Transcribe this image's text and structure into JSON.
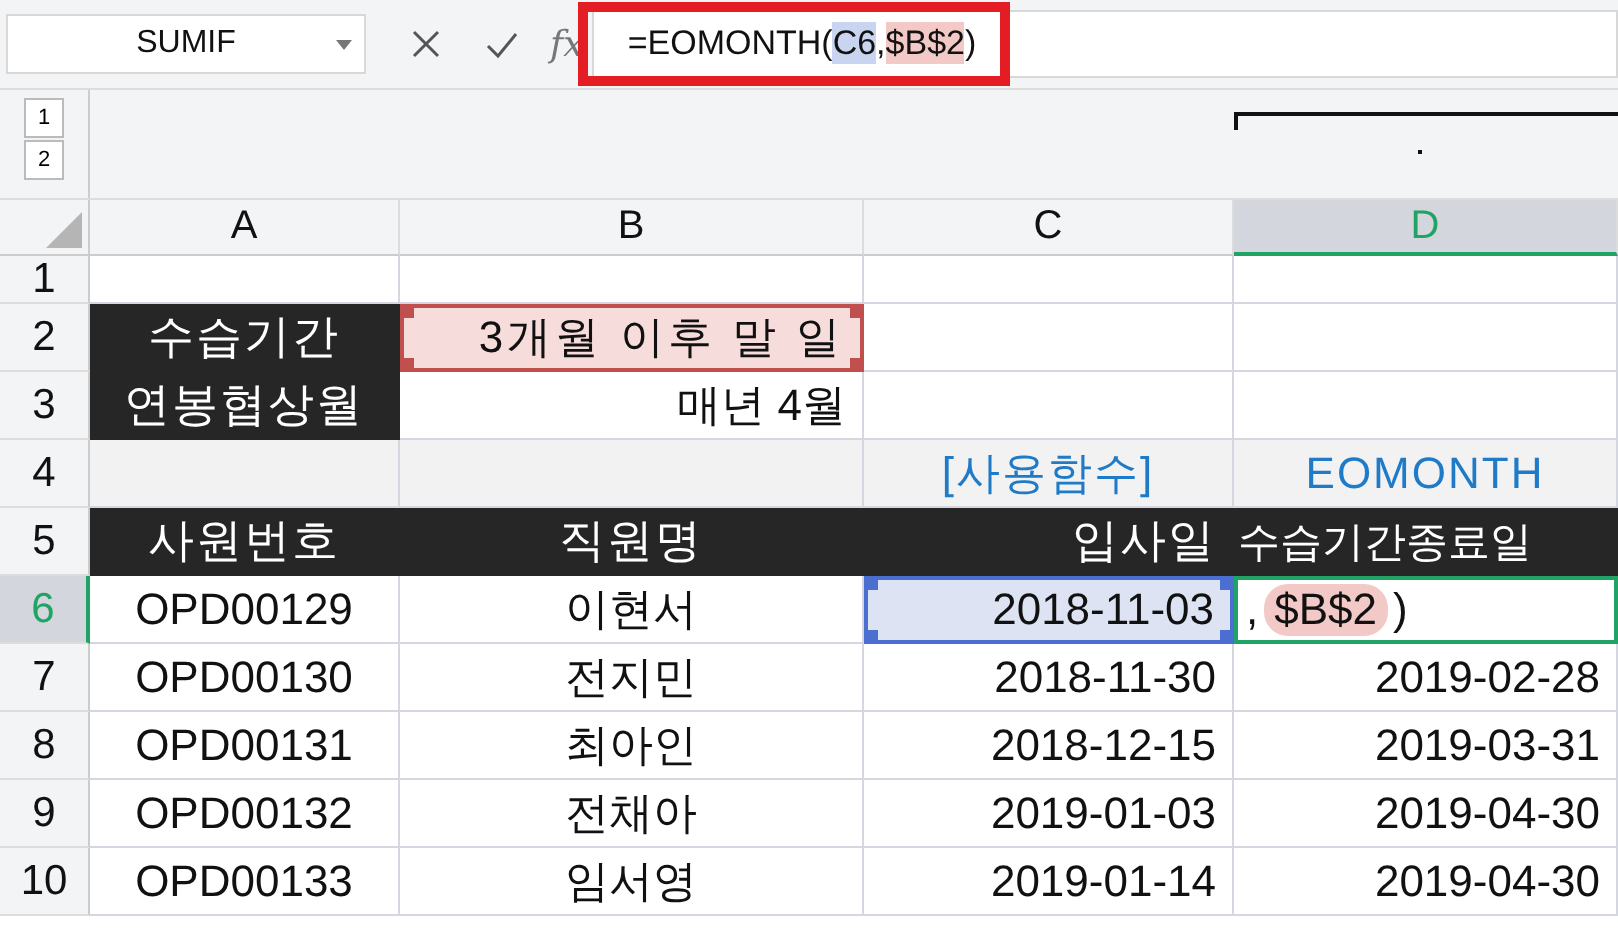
{
  "formula_bar": {
    "name_box": "SUMIF",
    "fx": "fx",
    "highlighted": true,
    "formula": [
      {
        "text": "=EOMONTH("
      },
      {
        "text": "C6",
        "color": "#c9d5f0"
      },
      {
        "text": ","
      },
      {
        "text": "$B$2",
        "color": "#f2c9c6"
      },
      {
        "text": ")"
      }
    ]
  },
  "outline_levels": [
    "1",
    "2"
  ],
  "columns": [
    {
      "label": "A",
      "selected": false
    },
    {
      "label": "B",
      "selected": false
    },
    {
      "label": "C",
      "selected": false
    },
    {
      "label": "D",
      "selected": true
    }
  ],
  "rows": [
    {
      "header": "1",
      "selected": false,
      "cells": [
        {
          "kind": "text"
        },
        {
          "kind": "text"
        },
        {
          "kind": "text"
        },
        {
          "kind": "text"
        }
      ]
    },
    {
      "header": "2",
      "selected": false,
      "cells": [
        {
          "kind": "dark",
          "text": "수습기간"
        },
        {
          "kind": "ref-pink",
          "text": "3개월 이후 말 일"
        },
        {
          "kind": "text"
        },
        {
          "kind": "text"
        }
      ]
    },
    {
      "header": "3",
      "selected": false,
      "cells": [
        {
          "kind": "dark",
          "text": "연봉협상월"
        },
        {
          "kind": "value",
          "text": "매년 4월"
        },
        {
          "kind": "text"
        },
        {
          "kind": "text"
        }
      ]
    },
    {
      "header": "4",
      "selected": false,
      "cells": [
        {
          "kind": "band"
        },
        {
          "kind": "band"
        },
        {
          "kind": "note",
          "text": "[사용함수]"
        },
        {
          "kind": "note",
          "text": "EOMONTH"
        }
      ]
    },
    {
      "header": "5",
      "selected": false,
      "cells": [
        {
          "kind": "dark",
          "text": "사원번호"
        },
        {
          "kind": "dark",
          "text": "직원명"
        },
        {
          "kind": "dark-value",
          "text": "입사일"
        },
        {
          "kind": "dark-overflow",
          "text": "수습기간종료일"
        }
      ]
    },
    {
      "header": "6",
      "selected": true,
      "cells": [
        {
          "kind": "text",
          "text": "OPD00129"
        },
        {
          "kind": "text",
          "text": "이현서"
        },
        {
          "kind": "ref-blue",
          "text": "2018-11-03"
        },
        {
          "kind": "editing",
          "parts": [
            {
              "text": ","
            },
            {
              "text": "$B$2",
              "color": "#f2c9c6"
            },
            {
              "text": ")"
            }
          ]
        }
      ]
    },
    {
      "header": "7",
      "selected": false,
      "cells": [
        {
          "kind": "text",
          "text": "OPD00130"
        },
        {
          "kind": "text",
          "text": "전지민"
        },
        {
          "kind": "value",
          "text": "2018-11-30"
        },
        {
          "kind": "value",
          "text": "2019-02-28"
        }
      ]
    },
    {
      "header": "8",
      "selected": false,
      "cells": [
        {
          "kind": "text",
          "text": "OPD00131"
        },
        {
          "kind": "text",
          "text": "최아인"
        },
        {
          "kind": "value",
          "text": "2018-12-15"
        },
        {
          "kind": "value",
          "text": "2019-03-31"
        }
      ]
    },
    {
      "header": "9",
      "selected": false,
      "cells": [
        {
          "kind": "text",
          "text": "OPD00132"
        },
        {
          "kind": "text",
          "text": "전채아"
        },
        {
          "kind": "value",
          "text": "2019-01-03"
        },
        {
          "kind": "value",
          "text": "2019-04-30"
        }
      ]
    },
    {
      "header": "10",
      "selected": false,
      "cells": [
        {
          "kind": "text",
          "text": "OPD00133"
        },
        {
          "kind": "text",
          "text": "임서영"
        },
        {
          "kind": "value",
          "text": "2019-01-14"
        },
        {
          "kind": "value",
          "text": "2019-04-30"
        }
      ]
    }
  ]
}
